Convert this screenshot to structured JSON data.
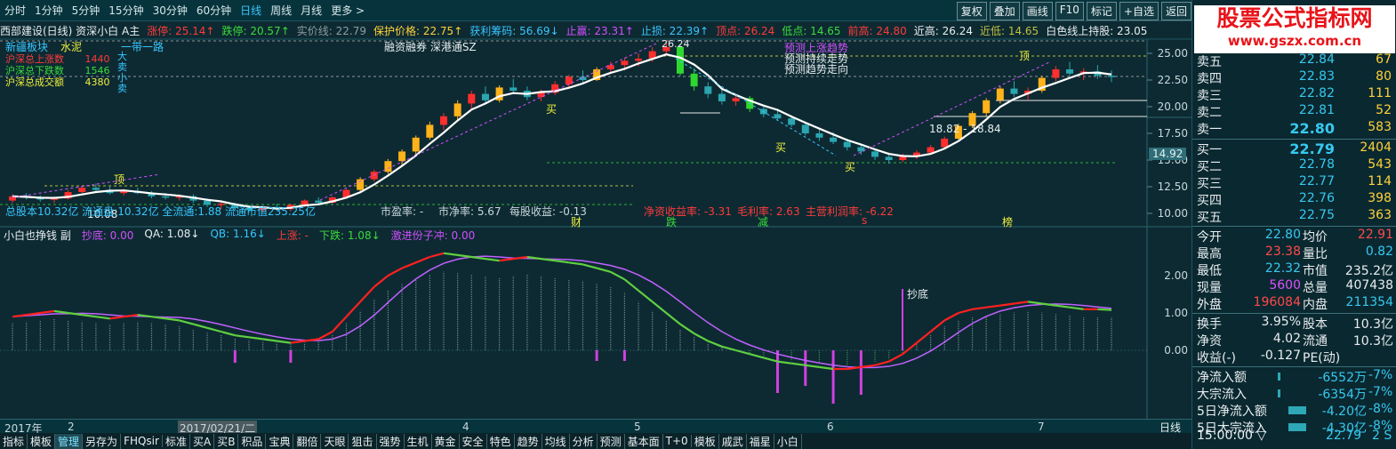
{
  "periods": [
    "分时",
    "1分钟",
    "5分钟",
    "15分钟",
    "30分钟",
    "60分钟",
    "日线",
    "周线",
    "月线",
    "更多 >"
  ],
  "active_period": "日线",
  "toolbar": [
    "复权",
    "叠加",
    "画线",
    "F10",
    "标记",
    "+自选",
    "返回"
  ],
  "info": [
    {
      "text": "西部建设(日线) 资深小白 A主",
      "color": "#e8eef0"
    },
    {
      "text": "涨停: 25.14↑",
      "color": "#ff3a3a"
    },
    {
      "text": "跌停: 20.57↑",
      "color": "#3adc3a"
    },
    {
      "text": "实价线: 22.79",
      "color": "#8c9ca0"
    },
    {
      "text": "保护价格: 22.75↑",
      "color": "#ffd23a"
    },
    {
      "text": "获利筹码: 56.69↓",
      "color": "#38c6ff"
    },
    {
      "text": "止赢: 23.31↑",
      "color": "#d050ff"
    },
    {
      "text": "止损: 22.39↑",
      "color": "#38c6ff"
    },
    {
      "text": "顶点: 26.24",
      "color": "#ff3a3a"
    },
    {
      "text": "低点: 14.65",
      "color": "#3adc3a"
    },
    {
      "text": "前高: 24.80",
      "color": "#ff3a3a"
    },
    {
      "text": "近高: 26.24",
      "color": "#e8eef0"
    },
    {
      "text": "近低: 14.65",
      "color": "#c0c040"
    },
    {
      "text": "白色线上持股: 23.05↑",
      "color": "#e8eef0"
    }
  ],
  "logo": {
    "line1": "股票公式指标网",
    "line2": "www.gszx.com.cn"
  },
  "main_annotations": {
    "sector": "新疆板块",
    "sector2": "水泥",
    "sh_up": "沪深总上涨数",
    "sh_up_val": "1440",
    "sh_down": "沪深总下跌数",
    "sh_down_val": "1546",
    "sh_vol": "沪深总成交额",
    "sh_vol_val": "4380",
    "yidai": "一带一路",
    "side_text": "大卖小卖",
    "rongzi": "融资融券 深港通SZ",
    "top_marker": "26.24",
    "trend_up": "预测上涨趋势",
    "trend_cont": "预测持续走势",
    "trend_dir": "预测趋势走向",
    "range_label": "18.82 - 18.84",
    "low_label": "10.08",
    "ding": "顶",
    "buy": "买",
    "price_tag": "14.92",
    "stats": "总股本10.32亿   流通盘:10.32亿   全流通:1.88   流通市值235.25亿",
    "pe": "市盈率: -",
    "pb": "市净率: 5.67",
    "eps": "每股收益: -0.13",
    "roe": "净资收益率: -3.31",
    "gross": "毛利率: 2.63",
    "margin": "主营利润率: -6.22",
    "mark_cai": "财",
    "mark_die": "跌",
    "mark_jian": "减",
    "mark_s": "s",
    "mark_bang": "榜"
  },
  "price_axis": [
    "25.00",
    "22.50",
    "20.00",
    "17.50",
    "15.00",
    "12.50",
    "10.00"
  ],
  "sub_info": [
    {
      "text": "小白也挣钱 副",
      "color": "#e8eef0"
    },
    {
      "text": "抄底: 0.00",
      "color": "#d050ff"
    },
    {
      "text": "QA: 1.08↓",
      "color": "#e8eef0"
    },
    {
      "text": "QB: 1.16↓",
      "color": "#38c6ff"
    },
    {
      "text": "上涨: -",
      "color": "#ff3a3a"
    },
    {
      "text": "下跌: 1.08↓",
      "color": "#3adc3a"
    },
    {
      "text": "激进份子冲: 0.00",
      "color": "#d050ff"
    }
  ],
  "sub_axis": [
    "2.00",
    "1.00",
    "0.00"
  ],
  "sub_label": "抄底",
  "xaxis": [
    {
      "label": "2017年",
      "pos": 5
    },
    {
      "label": "2",
      "pos": 76
    },
    {
      "label": "2017/02/21/二",
      "pos": 200
    },
    {
      "label": "4",
      "pos": 520
    },
    {
      "label": "5",
      "pos": 713
    },
    {
      "label": "6",
      "pos": 930
    },
    {
      "label": "7",
      "pos": 1167
    }
  ],
  "right_bottom_tab": "日线",
  "bottom_tabs": [
    "指标",
    "模板",
    "管理",
    "另存为",
    "FHQsir",
    "标准",
    "买A",
    "买B",
    "积品",
    "宝典",
    "翻倍",
    "天眼",
    "狙击",
    "强势",
    "生机",
    "黄金",
    "安全",
    "特色",
    "趋势",
    "均线",
    "分析",
    "预测",
    "基本面",
    "T+0",
    "模板",
    "戚武",
    "福星",
    "小白"
  ],
  "active_bottom_tab": "管理",
  "order_book": {
    "asks": [
      {
        "label": "卖五",
        "price": "22.84",
        "vol": "67"
      },
      {
        "label": "卖四",
        "price": "22.83",
        "vol": "80"
      },
      {
        "label": "卖三",
        "price": "22.82",
        "vol": "111"
      },
      {
        "label": "卖二",
        "price": "22.81",
        "vol": "52"
      },
      {
        "label": "卖一",
        "price": "22.80",
        "vol": "583"
      }
    ],
    "bids": [
      {
        "label": "买一",
        "price": "22.79",
        "vol": "2404"
      },
      {
        "label": "买二",
        "price": "22.78",
        "vol": "543"
      },
      {
        "label": "买三",
        "price": "22.77",
        "vol": "114"
      },
      {
        "label": "买四",
        "price": "22.76",
        "vol": "398"
      },
      {
        "label": "买五",
        "price": "22.75",
        "vol": "363"
      }
    ]
  },
  "stats": [
    [
      {
        "t": "今开",
        "c": "#e8eef0"
      },
      {
        "t": "22.80",
        "c": "#37c9f0"
      },
      {
        "t": "均价",
        "c": "#e8eef0"
      },
      {
        "t": "22.91",
        "c": "#ff4a4a"
      }
    ],
    [
      {
        "t": "最高",
        "c": "#e8eef0"
      },
      {
        "t": "23.38",
        "c": "#ff4a4a"
      },
      {
        "t": "量比",
        "c": "#e8eef0"
      },
      {
        "t": "0.82",
        "c": "#37c9f0"
      }
    ],
    [
      {
        "t": "最低",
        "c": "#e8eef0"
      },
      {
        "t": "22.32",
        "c": "#37c9f0"
      },
      {
        "t": "市值",
        "c": "#e8eef0"
      },
      {
        "t": "235.2亿",
        "c": "#e8eef0"
      }
    ],
    [
      {
        "t": "现量",
        "c": "#e8eef0"
      },
      {
        "t": "5600",
        "c": "#e050ff"
      },
      {
        "t": "总量",
        "c": "#e8eef0"
      },
      {
        "t": "407438",
        "c": "#e8eef0"
      }
    ],
    [
      {
        "t": "外盘",
        "c": "#e8eef0"
      },
      {
        "t": "196084",
        "c": "#ff4a4a"
      },
      {
        "t": "内盘",
        "c": "#e8eef0"
      },
      {
        "t": "211354",
        "c": "#37c9f0"
      }
    ]
  ],
  "stats2": [
    [
      {
        "t": "换手",
        "c": "#e8eef0"
      },
      {
        "t": "3.95%",
        "c": "#e8eef0"
      },
      {
        "t": "股本",
        "c": "#e8eef0"
      },
      {
        "t": "10.3亿",
        "c": "#e8eef0"
      }
    ],
    [
      {
        "t": "净资",
        "c": "#e8eef0"
      },
      {
        "t": "4.02",
        "c": "#e8eef0"
      },
      {
        "t": "流通",
        "c": "#e8eef0"
      },
      {
        "t": "10.3亿",
        "c": "#e8eef0"
      }
    ],
    [
      {
        "t": "收益(-)",
        "c": "#e8eef0"
      },
      {
        "t": "-0.127",
        "c": "#e8eef0"
      },
      {
        "t": "PE(动)",
        "c": "#e8eef0"
      },
      {
        "t": "",
        "c": "#e8eef0"
      }
    ]
  ],
  "flows": [
    {
      "label": "净流入额",
      "val": "-6552万",
      "pct": "-7%"
    },
    {
      "label": "大宗流入",
      "val": "-6354万",
      "pct": "-7%"
    },
    {
      "label": "5日净流入额",
      "val": "-4.20亿",
      "pct": "-8%"
    },
    {
      "label": "5日大宗流入",
      "val": "-4.30亿",
      "pct": "-8%"
    }
  ],
  "time_row": {
    "time": "15:00:00",
    "arrow": "▽",
    "price": "22.79",
    "vol": "2 S"
  },
  "kline": [
    [
      11.2,
      11.8,
      11.0,
      11.6
    ],
    [
      11.6,
      11.9,
      11.3,
      11.5
    ],
    [
      11.5,
      11.7,
      11.1,
      11.3
    ],
    [
      11.3,
      11.6,
      11.0,
      11.4
    ],
    [
      11.4,
      12.2,
      11.3,
      12.0
    ],
    [
      12.0,
      12.6,
      11.9,
      12.4
    ],
    [
      12.4,
      12.8,
      12.1,
      12.2
    ],
    [
      12.2,
      12.5,
      11.8,
      11.9
    ],
    [
      11.9,
      12.3,
      11.7,
      12.1
    ],
    [
      12.1,
      12.4,
      11.8,
      11.9
    ],
    [
      11.9,
      12.1,
      11.4,
      11.6
    ],
    [
      11.6,
      11.9,
      11.3,
      11.5
    ],
    [
      11.5,
      11.8,
      11.2,
      11.6
    ],
    [
      11.6,
      11.8,
      11.0,
      11.2
    ],
    [
      11.2,
      11.4,
      10.6,
      10.8
    ],
    [
      10.8,
      11.1,
      10.4,
      10.9
    ],
    [
      10.9,
      11.0,
      10.3,
      10.5
    ],
    [
      10.5,
      10.8,
      10.1,
      10.3
    ],
    [
      10.3,
      10.7,
      10.1,
      10.6
    ],
    [
      10.6,
      10.9,
      10.3,
      10.4
    ],
    [
      10.4,
      10.9,
      10.2,
      10.8
    ],
    [
      10.8,
      11.3,
      10.6,
      11.2
    ],
    [
      11.2,
      11.5,
      10.9,
      11.0
    ],
    [
      11.0,
      11.6,
      10.9,
      11.5
    ],
    [
      11.5,
      12.3,
      11.4,
      12.2
    ],
    [
      12.2,
      13.4,
      12.1,
      13.2
    ],
    [
      13.2,
      14.1,
      13.0,
      13.9
    ],
    [
      13.9,
      15.1,
      13.7,
      14.9
    ],
    [
      14.9,
      16.0,
      14.5,
      15.8
    ],
    [
      15.8,
      17.3,
      15.5,
      17.1
    ],
    [
      17.1,
      18.6,
      16.9,
      18.3
    ],
    [
      18.3,
      19.4,
      17.8,
      19.1
    ],
    [
      19.1,
      20.6,
      18.8,
      20.3
    ],
    [
      20.3,
      21.5,
      19.8,
      21.2
    ],
    [
      21.2,
      21.9,
      20.2,
      20.6
    ],
    [
      20.6,
      22.0,
      20.4,
      21.8
    ],
    [
      21.8,
      22.6,
      21.2,
      21.5
    ],
    [
      21.5,
      21.9,
      20.6,
      20.9
    ],
    [
      20.9,
      21.6,
      20.5,
      21.3
    ],
    [
      21.3,
      22.4,
      21.1,
      22.1
    ],
    [
      22.1,
      23.0,
      21.8,
      22.8
    ],
    [
      22.8,
      23.4,
      22.2,
      22.5
    ],
    [
      22.5,
      23.7,
      22.4,
      23.5
    ],
    [
      23.5,
      24.2,
      23.1,
      23.9
    ],
    [
      23.9,
      24.6,
      23.4,
      24.3
    ],
    [
      24.3,
      25.0,
      23.8,
      24.5
    ],
    [
      24.5,
      25.6,
      24.2,
      25.2
    ],
    [
      25.2,
      26.24,
      24.8,
      25.6
    ],
    [
      25.6,
      25.9,
      22.9,
      23.1
    ],
    [
      23.1,
      23.6,
      21.5,
      21.9
    ],
    [
      21.9,
      22.3,
      20.8,
      21.2
    ],
    [
      21.2,
      21.6,
      20.2,
      20.5
    ],
    [
      20.5,
      21.1,
      20.1,
      20.8
    ],
    [
      20.8,
      21.0,
      19.5,
      19.8
    ],
    [
      19.8,
      20.2,
      19.0,
      19.3
    ],
    [
      19.3,
      19.8,
      18.7,
      18.9
    ],
    [
      18.9,
      19.2,
      18.1,
      18.3
    ],
    [
      18.3,
      18.6,
      17.3,
      17.5
    ],
    [
      17.5,
      17.9,
      16.8,
      17.1
    ],
    [
      17.1,
      17.6,
      16.5,
      16.7
    ],
    [
      16.7,
      17.0,
      15.9,
      16.2
    ],
    [
      16.2,
      16.5,
      15.5,
      15.8
    ],
    [
      15.8,
      16.1,
      15.0,
      15.3
    ],
    [
      15.3,
      15.7,
      14.65,
      15.0
    ],
    [
      15.0,
      15.6,
      14.8,
      15.4
    ],
    [
      15.4,
      15.9,
      15.1,
      15.7
    ],
    [
      15.7,
      16.4,
      15.5,
      16.2
    ],
    [
      16.2,
      17.2,
      16.0,
      17.0
    ],
    [
      17.0,
      18.4,
      16.9,
      18.2
    ],
    [
      18.2,
      19.6,
      18.0,
      19.4
    ],
    [
      19.4,
      20.8,
      19.1,
      20.6
    ],
    [
      20.6,
      21.9,
      20.3,
      21.7
    ],
    [
      21.7,
      22.4,
      20.9,
      21.2
    ],
    [
      21.2,
      21.8,
      20.6,
      21.5
    ],
    [
      21.5,
      22.9,
      21.3,
      22.7
    ],
    [
      22.7,
      23.8,
      22.4,
      23.5
    ],
    [
      23.5,
      24.2,
      22.9,
      23.1
    ],
    [
      23.1,
      23.6,
      22.5,
      23.3
    ],
    [
      23.3,
      23.9,
      22.6,
      22.9
    ],
    [
      22.9,
      23.4,
      22.3,
      22.79
    ]
  ],
  "osc": [
    0.9,
    0.95,
    1.0,
    1.05,
    1.0,
    0.95,
    0.9,
    0.85,
    0.9,
    0.95,
    0.9,
    0.85,
    0.8,
    0.7,
    0.6,
    0.5,
    0.4,
    0.35,
    0.3,
    0.25,
    0.2,
    0.25,
    0.3,
    0.5,
    0.9,
    1.3,
    1.7,
    2.0,
    2.2,
    2.35,
    2.5,
    2.6,
    2.55,
    2.5,
    2.45,
    2.4,
    2.45,
    2.5,
    2.45,
    2.4,
    2.35,
    2.3,
    2.2,
    2.1,
    1.9,
    1.6,
    1.3,
    1.0,
    0.7,
    0.45,
    0.25,
    0.1,
    0.0,
    -0.1,
    -0.2,
    -0.3,
    -0.35,
    -0.4,
    -0.45,
    -0.5,
    -0.5,
    -0.45,
    -0.4,
    -0.3,
    -0.1,
    0.2,
    0.5,
    0.8,
    1.0,
    1.1,
    1.15,
    1.2,
    1.25,
    1.3,
    1.25,
    1.2,
    1.15,
    1.1,
    1.1,
    1.08
  ]
}
